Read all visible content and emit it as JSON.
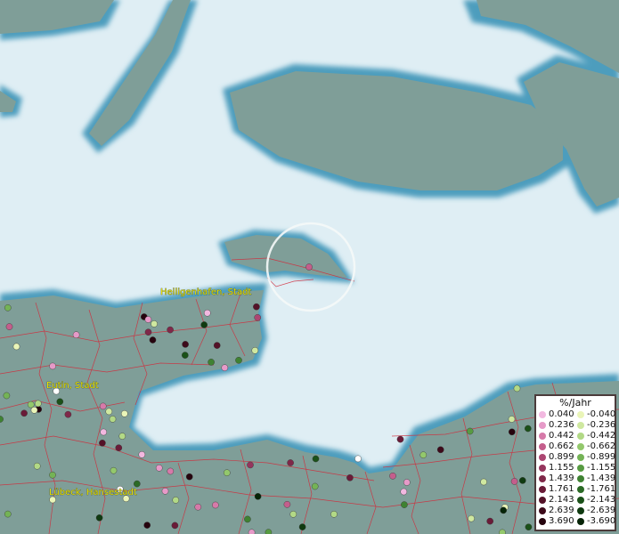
{
  "map": {
    "places": [
      {
        "name": "Heiligenhafen, Stadt"
      },
      {
        "name": "Eutin, Stadt"
      },
      {
        "name": "Lübeck, Hansestadt"
      }
    ],
    "colors": {
      "water": "#dfeef4",
      "land": "#7f9e98",
      "coast": "#4d9dbd",
      "boundary": "#d22a3a"
    }
  },
  "legend": {
    "title": "%/Jahr",
    "positive": [
      {
        "label": "0.040",
        "color": "#f2b8e0"
      },
      {
        "label": "0.236",
        "color": "#e69ac8"
      },
      {
        "label": "0.442",
        "color": "#d67aa9"
      },
      {
        "label": "0.662",
        "color": "#c45e8c"
      },
      {
        "label": "0.899",
        "color": "#ac4672"
      },
      {
        "label": "1.155",
        "color": "#95355d"
      },
      {
        "label": "1.439",
        "color": "#7f2849"
      },
      {
        "label": "1.761",
        "color": "#6a1b38"
      },
      {
        "label": "2.143",
        "color": "#541228"
      },
      {
        "label": "2.639",
        "color": "#3d0a1a"
      },
      {
        "label": "3.690",
        "color": "#26040e"
      }
    ],
    "negative": [
      {
        "label": "-0.040",
        "color": "#eaf5b8"
      },
      {
        "label": "-0.236",
        "color": "#cfe8a0"
      },
      {
        "label": "-0.442",
        "color": "#b2d986"
      },
      {
        "label": "-0.662",
        "color": "#93c86c"
      },
      {
        "label": "-0.899",
        "color": "#74b356"
      },
      {
        "label": "-1.155",
        "color": "#579b42"
      },
      {
        "label": "-1.439",
        "color": "#3f8232"
      },
      {
        "label": "-1.761",
        "color": "#2b6a25"
      },
      {
        "label": "-2.143",
        "color": "#1b5119"
      },
      {
        "label": "-2.639",
        "color": "#0f3a10"
      },
      {
        "label": "-3.690",
        "color": "#062407"
      }
    ]
  }
}
